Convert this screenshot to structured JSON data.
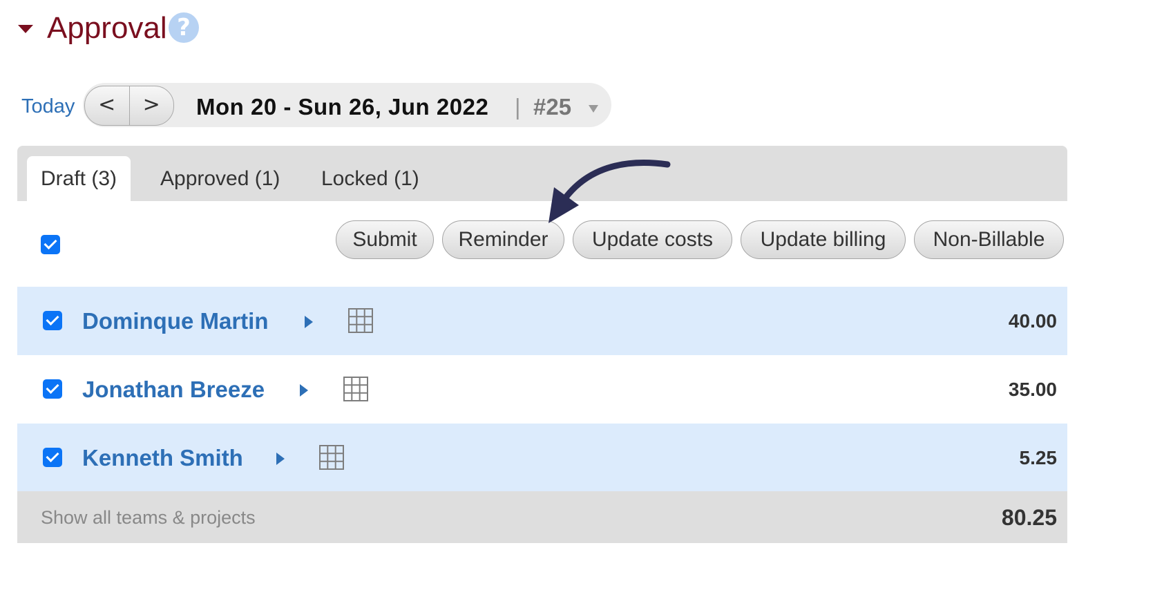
{
  "header": {
    "title": "Approval",
    "help_icon": "question-circle-icon",
    "help_glyph": "?"
  },
  "date_nav": {
    "today_label": "Today",
    "prev_label": "<",
    "next_label": ">",
    "range": "Mon 20 - Sun 26, Jun 2022",
    "separator": "|",
    "week_number": "#25"
  },
  "tabs": [
    {
      "label": "Draft (3)",
      "active": true
    },
    {
      "label": "Approved (1)",
      "active": false
    },
    {
      "label": "Locked (1)",
      "active": false
    }
  ],
  "select_all": {
    "checked": true
  },
  "actions": [
    {
      "label": "Submit"
    },
    {
      "label": "Reminder"
    },
    {
      "label": "Update costs"
    },
    {
      "label": "Update billing"
    },
    {
      "label": "Non-Billable"
    }
  ],
  "rows": [
    {
      "name": "Dominque Martin",
      "hours": "40.00",
      "checked": true
    },
    {
      "name": "Jonathan Breeze",
      "hours": "35.00",
      "checked": true
    },
    {
      "name": "Kenneth Smith",
      "hours": "5.25",
      "checked": true
    }
  ],
  "footer": {
    "link_label": "Show all teams & projects",
    "total": "80.25"
  },
  "colors": {
    "title": "#7a0f1f",
    "link": "#2d6fb6",
    "checkbox": "#0b74f6",
    "row_highlight": "#dcebfc",
    "annotation_arrow": "#2b2d55"
  }
}
